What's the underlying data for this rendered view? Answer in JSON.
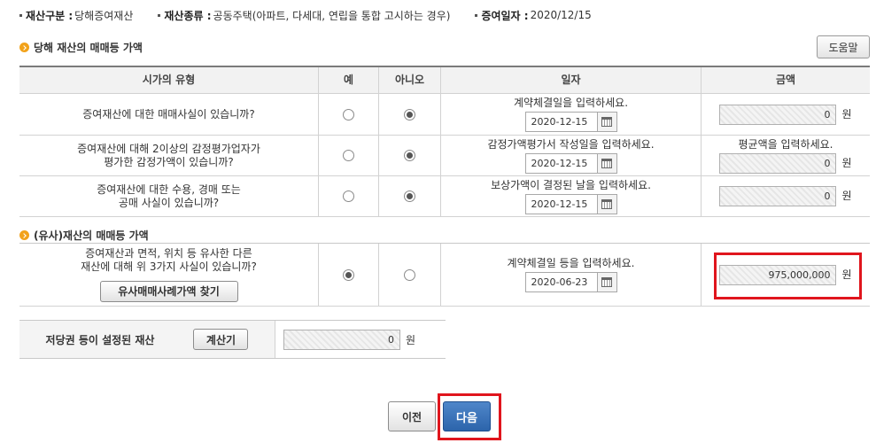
{
  "summary": {
    "category_label": "재산구분 :",
    "category_value": "당해증여재산",
    "type_label": "재산종류 :",
    "type_value": "공동주택(아파트, 다세대, 연립을 통합 고시하는 경우)",
    "date_label": "증여일자 :",
    "date_value": "2020/12/15"
  },
  "section1": {
    "title": "당해 재산의 매매등 가액",
    "help_button": "도움말",
    "headers": [
      "시가의 유형",
      "예",
      "아니오",
      "일자",
      "금액"
    ],
    "rows": [
      {
        "question": "증여재산에 대한 매매사실이 있습니까?",
        "question_line2": "",
        "yes_selected": false,
        "date_hint": "계약체결일을 입력하세요.",
        "date": "2020-12-15",
        "amount_hint": "",
        "amount": "0",
        "unit": "원"
      },
      {
        "question": "증여재산에 대해 2이상의 감정평가업자가",
        "question_line2": "평가한 감정가액이 있습니까?",
        "yes_selected": false,
        "date_hint": "감정가액평가서 작성일을 입력하세요.",
        "date": "2020-12-15",
        "amount_hint": "평균액을 입력하세요.",
        "amount": "0",
        "unit": "원"
      },
      {
        "question": "증여재산에 대한 수용, 경매 또는",
        "question_line2": "공매 사실이 있습니까?",
        "yes_selected": false,
        "date_hint": "보상가액이 결정된 날을 입력하세요.",
        "date": "2020-12-15",
        "amount_hint": "",
        "amount": "0",
        "unit": "원"
      }
    ]
  },
  "section2": {
    "title": "(유사)재산의 매매등 가액",
    "question": "증여재산과 면적, 위치 등 유사한 다른",
    "question_line2": "재산에 대해 위 3가지 사실이 있습니까?",
    "search_button": "유사매매사례가액 찾기",
    "yes_selected": true,
    "date_hint": "계약체결일 등을 입력하세요.",
    "date": "2020-06-23",
    "amount": "975,000,000",
    "unit": "원"
  },
  "mortgage": {
    "label": "저당권 등이 설정된 재산",
    "calc_button": "계산기",
    "amount": "0",
    "unit": "원"
  },
  "nav": {
    "prev": "이전",
    "next": "다음"
  },
  "colors": {
    "highlight_red": "#e0151d",
    "section_icon": "#f2a21a",
    "next_button": "#2c64ab"
  }
}
